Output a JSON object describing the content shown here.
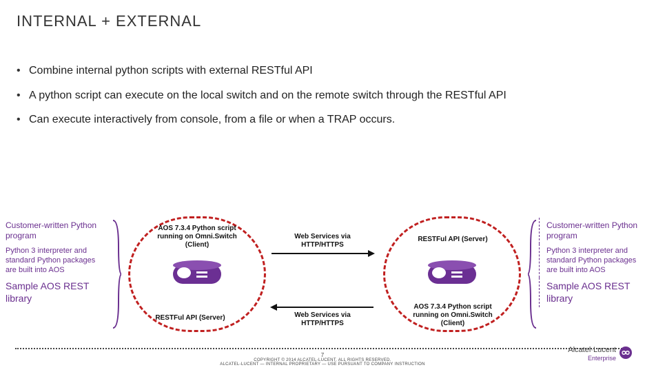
{
  "title": "INTERNAL + EXTERNAL",
  "bullets": {
    "b1": "Combine internal python scripts with external RESTful API",
    "b2": "A python script can execute on the local switch and on the remote switch through the RESTful API",
    "b3": "Can execute interactively from console, from a file or when a TRAP occurs."
  },
  "side": {
    "box1": "Customer-written Python program",
    "box2": "Python 3 interpreter and standard Python packages are built into AOS",
    "box3": "Sample AOS REST library"
  },
  "labels": {
    "client_top": "AOS 7.3.4\nPython script running on Omni.Switch (Client)",
    "server_bottom": "RESTFul API (Server)",
    "web_top": "Web Services via HTTP/HTTPS",
    "web_bottom": "Web Services via HTTP/HTTPS",
    "server_top_right": "RESTFul API (Server)",
    "client_bottom_right": "AOS 7.3.4\nPython script running on Omni.Switch (Client)"
  },
  "footer": {
    "page": "7",
    "copyright": "COPYRIGHT © 2014 ALCATEL-LUCENT. ALL RIGHTS RESERVED.",
    "proprietary": "ALCATEL-LUCENT — INTERNAL PROPRIETARY — USE PURSUANT TO COMPANY INSTRUCTION"
  },
  "brand": {
    "name": "Alcatel·Lucent",
    "sub": "Enterprise"
  }
}
